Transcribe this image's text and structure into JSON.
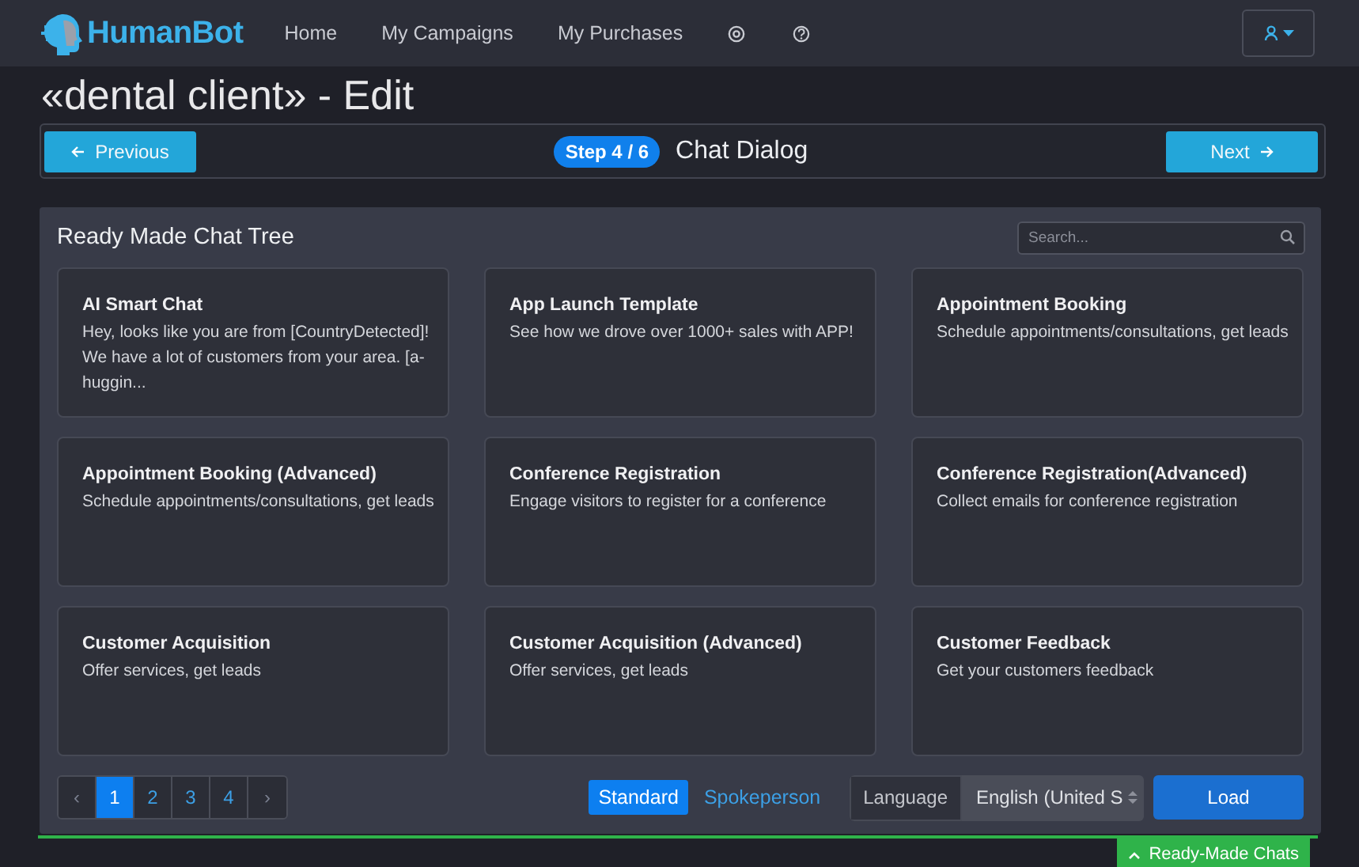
{
  "nav": {
    "brand": "HumanBot",
    "links": [
      {
        "label": "Home"
      },
      {
        "label": "My Campaigns"
      },
      {
        "label": "My Purchases"
      }
    ]
  },
  "page_title": "«dental client» - Edit",
  "stepper": {
    "previous": "Previous",
    "step_badge": "Step 4 / 6",
    "step_title": "Chat Dialog",
    "next": "Next"
  },
  "panel": {
    "title": "Ready Made Chat Tree",
    "search": {
      "placeholder": "Search..."
    },
    "templates": [
      {
        "title": "AI Smart Chat",
        "description": "Hey, looks like you are from [CountryDetected]! We have a lot of customers from your area. [a-huggin..."
      },
      {
        "title": "App Launch Template",
        "description": "See how we drove over 1000+ sales with APP!"
      },
      {
        "title": "Appointment Booking",
        "description": "Schedule appointments/consultations, get leads"
      },
      {
        "title": "Appointment Booking (Advanced)",
        "description": "Schedule appointments/consultations, get leads"
      },
      {
        "title": "Conference Registration",
        "description": "Engage visitors to register for a conference"
      },
      {
        "title": "Conference Registration(Advanced)",
        "description": "Collect emails for conference registration"
      },
      {
        "title": "Customer Acquisition",
        "description": "Offer services, get leads"
      },
      {
        "title": "Customer Acquisition (Advanced)",
        "description": "Offer services, get leads"
      },
      {
        "title": "Customer Feedback",
        "description": "Get your customers feedback"
      }
    ],
    "pagination": {
      "prev": "‹",
      "pages": [
        {
          "label": "1",
          "selected": true
        },
        {
          "label": "2",
          "selected": false
        },
        {
          "label": "3",
          "selected": false
        },
        {
          "label": "4",
          "selected": false
        }
      ],
      "next": "›"
    },
    "modes": [
      {
        "label": "Standard",
        "selected": true
      },
      {
        "label": "Spokeperson",
        "selected": false
      }
    ],
    "language": {
      "label": "Language",
      "value": "English (United S"
    },
    "load": "Load"
  },
  "footer_tab": "Ready-Made Chats"
}
